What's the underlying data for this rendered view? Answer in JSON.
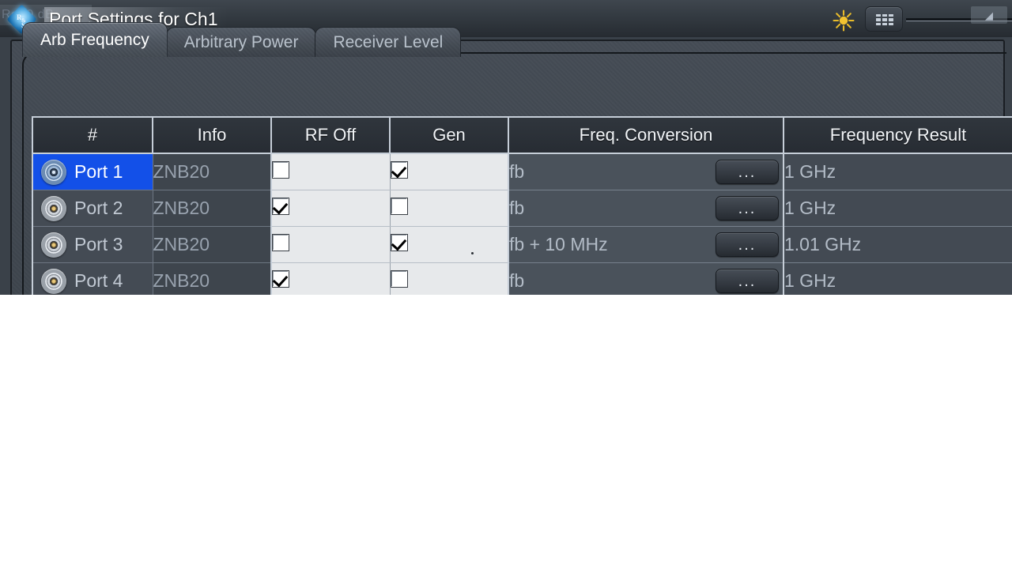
{
  "window": {
    "title": "Port Settings for Ch1",
    "logo_name": "R&S",
    "background_trace_text": "Ref 0 dB"
  },
  "titlebar": {
    "brightness_icon": "sun-icon",
    "keypad_icon": "keypad-icon",
    "slider_marker": "◢"
  },
  "tabs": [
    {
      "label": "Arb Frequency",
      "active": true
    },
    {
      "label": "Arbitrary Power",
      "active": false
    },
    {
      "label": "Receiver Level",
      "active": false
    }
  ],
  "table": {
    "columns": [
      "#",
      "Info",
      "RF Off",
      "Gen",
      "Freq. Conversion",
      "Frequency Result"
    ],
    "ellipsis_label": "...",
    "rows": [
      {
        "port": "Port 1",
        "port_icon": "coax-port-icon",
        "info": "ZNB20",
        "rf_off": false,
        "gen": true,
        "conversion": "fb",
        "result": "1 GHz",
        "selected": true
      },
      {
        "port": "Port 2",
        "port_icon": "coax-port-icon",
        "info": "ZNB20",
        "rf_off": true,
        "gen": false,
        "conversion": "fb",
        "result": "1 GHz",
        "selected": false
      },
      {
        "port": "Port 3",
        "port_icon": "coax-port-icon",
        "info": "ZNB20",
        "rf_off": false,
        "gen": true,
        "conversion": "fb + 10 MHz",
        "result": "1.01 GHz",
        "selected": false
      },
      {
        "port": "Port 4",
        "port_icon": "coax-port-icon",
        "info": "ZNB20",
        "rf_off": true,
        "gen": false,
        "conversion": "fb",
        "result": "1 GHz",
        "selected": false
      }
    ]
  },
  "colors": {
    "selection_blue": "#1350e8",
    "panel_bg": "#3e454d",
    "header_bg": "#272c33",
    "checkbox_cell_bg": "#e7e9eb",
    "accent_sun": "#f2c230"
  }
}
